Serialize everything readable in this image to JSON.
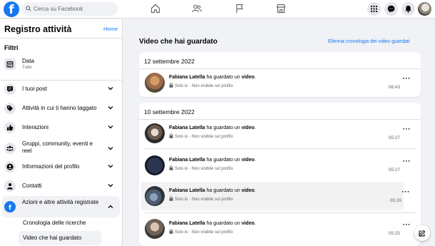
{
  "topbar": {
    "logo": "f",
    "search_placeholder": "Cerca su Facebook",
    "nav_icons": [
      "home-icon",
      "friends-icon",
      "flag-icon",
      "marketplace-icon"
    ],
    "right_icons": [
      "menu-grid-icon",
      "messenger-icon",
      "notifications-icon"
    ]
  },
  "sidebar": {
    "title": "Registro attività",
    "home_link": "Home",
    "filters_label": "Filtri",
    "date_filter": {
      "label": "Data",
      "value": "Tutto",
      "icon": "calendar-icon"
    },
    "items": [
      {
        "label": "I tuoi post",
        "icon": "post-icon"
      },
      {
        "label": "Attività in cui ti hanno taggato",
        "icon": "tag-icon"
      },
      {
        "label": "Interazioni",
        "icon": "like-icon"
      },
      {
        "label": "Gruppi, community, eventi e reel",
        "icon": "groups-icon"
      },
      {
        "label": "Informazioni del profilo",
        "icon": "profile-icon"
      },
      {
        "label": "Contatti",
        "icon": "contacts-icon"
      },
      {
        "label": "Azioni e altre attività registrate",
        "icon": "facebook-icon"
      }
    ],
    "subitems": [
      "Cronologia delle ricerche",
      "Video che hai guardato"
    ]
  },
  "main": {
    "heading": "Video che hai guardato",
    "clear_link": "Elimina cronologia dei video guardati",
    "groups": [
      {
        "date": "12 settembre 2022",
        "entries": [
          {
            "name": "Fabiana Latella",
            "action": "ha guardato un",
            "object": "video",
            "privacy": "Solo io",
            "visibility": "Non visibile sul profilo",
            "time": "06:43"
          }
        ]
      },
      {
        "date": "10 settembre 2022",
        "entries": [
          {
            "name": "Fabiana Latella",
            "action": "ha guardato un",
            "object": "video",
            "privacy": "Solo io",
            "visibility": "Non visibile sul profilo",
            "time": "05:27"
          },
          {
            "name": "Fabiana Latella",
            "action": "ha guardato un",
            "object": "video",
            "privacy": "Solo io",
            "visibility": "Non visibile sul profilo",
            "time": "05:27"
          },
          {
            "name": "Fabiana Latella",
            "action": "ha guardato un",
            "object": "video",
            "privacy": "Solo io",
            "visibility": "Non visibile sul profilo",
            "time": "05:26"
          },
          {
            "name": "Fabiana Latella",
            "action": "ha guardato un",
            "object": "video",
            "privacy": "Solo io",
            "visibility": "Non visibile sul profilo",
            "time": "05:25"
          }
        ]
      }
    ]
  },
  "colors": {
    "brand": "#1877f2",
    "background": "#f0f2f5",
    "secondary_text": "#65676b"
  }
}
